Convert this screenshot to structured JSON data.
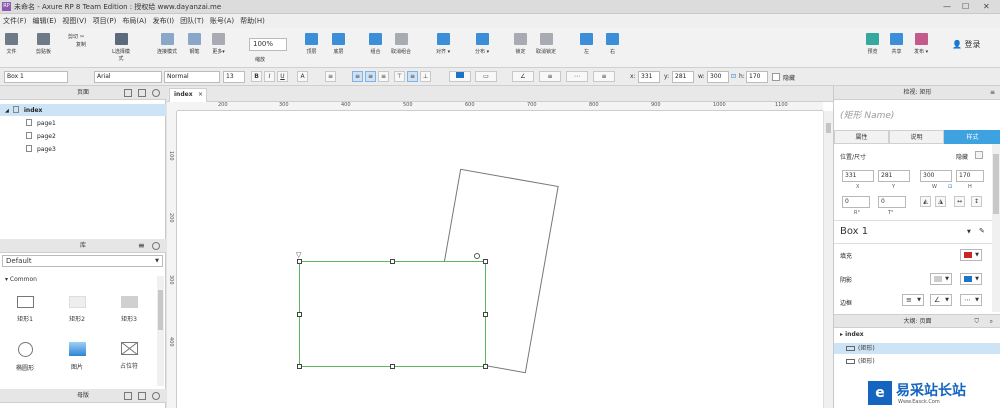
{
  "window": {
    "title": "未命名 - Axure RP 8 Team Edition : 授权给 www.dayanzai.me",
    "logo_text": "RP",
    "minimize": "—",
    "maximize": "☐",
    "close": "✕"
  },
  "menu": [
    "文件(F)",
    "编辑(E)",
    "视图(V)",
    "项目(P)",
    "布局(A)",
    "发布(I)",
    "团队(T)",
    "账号(A)",
    "帮助(H)"
  ],
  "toolbar": {
    "file": "文件",
    "clipboard": "剪贴板",
    "cut": "剪切",
    "copy": "复制",
    "paste": "粘贴",
    "select_mode": "L选择模式",
    "connect_mode": "连接模式",
    "pen": "钢笔",
    "more": "更多▾",
    "zoom": "100%",
    "zoom_label": "缩放",
    "top": "顶层",
    "bottom": "底层",
    "group": "组合",
    "ungroup": "取消组合",
    "align": "对齐 ▾",
    "distribute": "分布 ▾",
    "lock": "锁定",
    "unlock": "取消锁定",
    "left": "左",
    "right": "右",
    "preview": "预览",
    "share": "共享",
    "publish": "发布 ▾",
    "login": "登录"
  },
  "format": {
    "widget_name": "Box 1",
    "font": "Arial",
    "weight": "Normal",
    "size": "13",
    "bold": "B",
    "italic": "I",
    "underline": "U",
    "x_label": "x:",
    "x": "331",
    "y_label": "y:",
    "y": "281",
    "w_label": "w:",
    "w": "300",
    "h_label": "h:",
    "h": "170",
    "hidden": "隐藏"
  },
  "pages": {
    "header": "页面",
    "items": [
      "index",
      "page1",
      "page2",
      "page3"
    ]
  },
  "library": {
    "header": "库",
    "selected": "Default",
    "group": "Common",
    "widgets": [
      "矩形1",
      "矩形2",
      "矩形3",
      "椭圆形",
      "图片",
      "占位符"
    ]
  },
  "masters": {
    "header": "母版"
  },
  "canvas": {
    "tab": "index",
    "ruler_h": [
      "200",
      "300",
      "400",
      "500",
      "600",
      "700",
      "800",
      "900",
      "1000",
      "1100"
    ],
    "ruler_v": [
      "100",
      "200",
      "300",
      "400"
    ]
  },
  "inspector": {
    "header": "检视: 矩形",
    "name_placeholder": "(矩形 Name)",
    "tabs": [
      "属性",
      "说明",
      "样式"
    ],
    "position_label": "位置/尺寸",
    "hidden": "隐藏",
    "x": "331",
    "y": "281",
    "w": "300",
    "h": "170",
    "x_cap": "X",
    "y_cap": "Y",
    "w_cap": "W",
    "h_cap": "H",
    "r": "0",
    "t": "0",
    "r_cap": "R°",
    "t_cap": "T°",
    "style_name": "Box 1",
    "fill": "填充",
    "shadow": "阴影",
    "border": "边框",
    "fill_color": "#c62828",
    "shadow_color": "#1e73c8"
  },
  "outline": {
    "header": "大纲: 页面",
    "root": "index",
    "items": [
      "(矩形)",
      "(矩形)"
    ]
  },
  "watermark": {
    "text": "易采站长站",
    "sub": "Www.Easck.Com"
  }
}
